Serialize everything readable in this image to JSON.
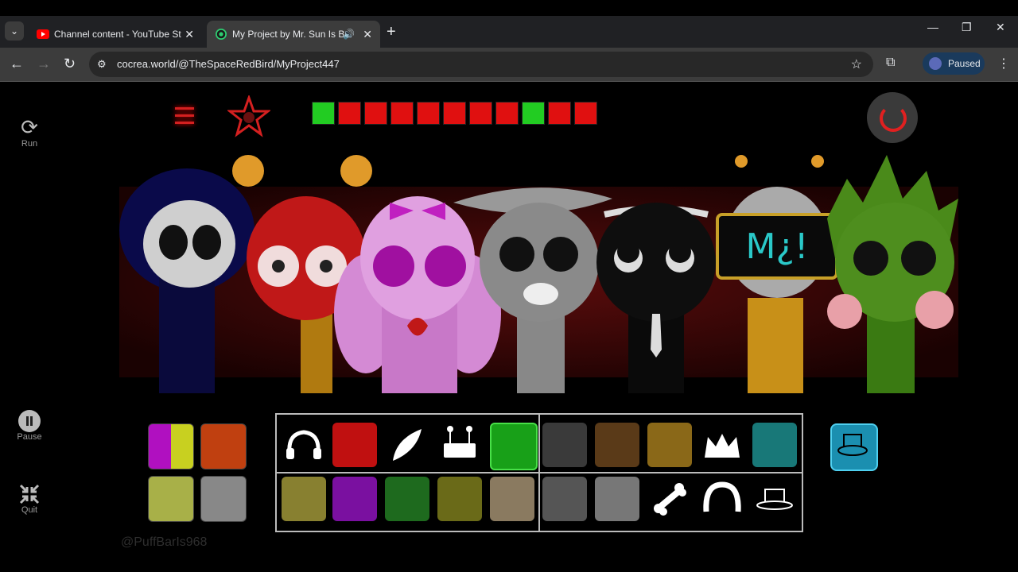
{
  "tabs": [
    {
      "title": "Channel content - YouTube Studio",
      "favicon": "youtube-icon",
      "active": false
    },
    {
      "title": "My Project by Mr. Sun Is Be",
      "favicon": "cocrea-icon",
      "active": true,
      "audio": true
    }
  ],
  "address_bar": {
    "url": "cocrea.world/@TheSpaceRedBird/MyProject447"
  },
  "profile": {
    "status": "Paused"
  },
  "side_controls": {
    "run_label": "Run",
    "pause_label": "Pause",
    "quit_label": "Quit"
  },
  "watermark": "@PuffBarIs968",
  "colors": {
    "accent_red": "#e02020",
    "selected_green": "#22cc22",
    "panel_border": "#bbbbbb",
    "hat_button": "#1b8fb0"
  },
  "top_icons": [
    "green",
    "red",
    "red",
    "red",
    "red",
    "red",
    "red",
    "red",
    "green",
    "red",
    "red"
  ],
  "characters": [
    "hooded-blue",
    "red-antenna",
    "pink-bunny",
    "gray-hat",
    "black-top-hat",
    "tv-head",
    "green-spiky"
  ]
}
